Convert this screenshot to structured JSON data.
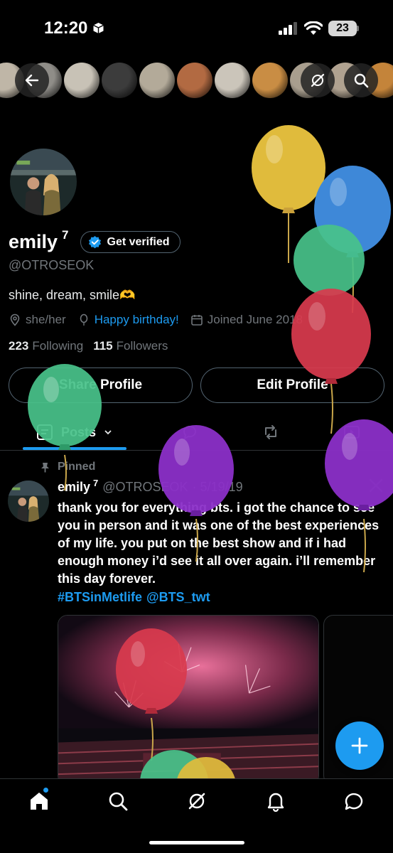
{
  "status": {
    "time": "12:20",
    "battery": "23"
  },
  "banner": {
    "moon_colors": [
      "#bfb6a7",
      "#8f8d88",
      "#c8c2b6",
      "#3c3c3c",
      "#b3aa99",
      "#b26a42",
      "#cbc5ba",
      "#c98d44",
      "#a89e8e",
      "#b0a290",
      "#c4843a"
    ]
  },
  "profile": {
    "display_name": "emily",
    "name_superscript": "7",
    "verify_label": "Get verified",
    "handle": "@OTROSEOK",
    "bio": "shine, dream, smile🫶",
    "pronouns": "she/her",
    "birthday_link": "Happy birthday!",
    "joined": "Joined June 2018",
    "following_count": "223",
    "following_label": "Following",
    "followers_count": "115",
    "followers_label": "Followers",
    "share_button": "Share Profile",
    "edit_button": "Edit Profile"
  },
  "tabs": {
    "posts_label": "Posts"
  },
  "tweet": {
    "pinned_label": "Pinned",
    "author_name": "emily",
    "author_superscript": "7",
    "author_handle": "@OTROSEOK",
    "date": "· 5/19/19",
    "text": "thank you for everything bts. i got the chance to see you in person and it was one of the best experiences of my life. you put on the best show and if i had enough money i’d see it all over again. i’ll remember this day forever.",
    "hashtag": "#BTSinMetlife",
    "mention": "@BTS_twt"
  },
  "colors": {
    "accent": "#1d9bf0",
    "background": "#000000",
    "muted": "#71767b"
  },
  "icons": {
    "back": "back-arrow-icon",
    "grok": "grok-icon",
    "search": "search-icon",
    "verified": "verified-badge-icon",
    "location": "location-pin-icon",
    "balloon": "balloon-icon",
    "calendar": "calendar-icon",
    "pin": "pin-icon",
    "compose": "plus-icon"
  }
}
